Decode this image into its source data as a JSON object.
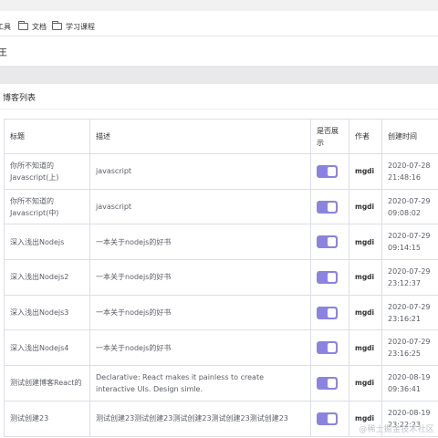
{
  "bookmarks": [
    {
      "label": "工具"
    },
    {
      "label": "文档"
    },
    {
      "label": "学习课程"
    }
  ],
  "header": {
    "crumb": "王"
  },
  "card": {
    "title": "博客列表"
  },
  "table": {
    "columns": [
      "标题",
      "描述",
      "是否展示",
      "作者",
      "创建时间"
    ],
    "rows": [
      {
        "title": "你所不知道的Javascript(上)",
        "desc": "javascript",
        "show": true,
        "author": "mgdi",
        "created": "2020-07-28 21:48:16"
      },
      {
        "title": "你所不知道的Javascript(中)",
        "desc": "javascript",
        "show": true,
        "author": "mgdi",
        "created": "2020-07-29 09:08:02"
      },
      {
        "title": "深入浅出Nodejs",
        "desc": "一本关于nodejs的好书",
        "show": true,
        "author": "mgdi",
        "created": "2020-07-29 09:14:15"
      },
      {
        "title": "深入浅出Nodejs2",
        "desc": "一本关于nodejs的好书",
        "show": true,
        "author": "mgdi",
        "created": "2020-07-29 23:12:37"
      },
      {
        "title": "深入浅出Nodejs3",
        "desc": "一本关于nodejs的好书",
        "show": true,
        "author": "mgdi",
        "created": "2020-07-29 23:16:21"
      },
      {
        "title": "深入浅出Nodejs4",
        "desc": "一本关于nodejs的好书",
        "show": true,
        "author": "mgdi",
        "created": "2020-07-29 23:16:25"
      },
      {
        "title": "测试创建博客React的",
        "desc": "Declarative: React makes it painless to create interactive UIs. Design simle.",
        "show": true,
        "author": "mgdi",
        "created": "2020-08-19 09:36:41"
      },
      {
        "title": "测试创建23",
        "desc": "测试创建23测试创建23测试创建23测试创建23测试创建23",
        "show": true,
        "author": "mgdi",
        "created": "2020-08-19 23:22:23"
      }
    ]
  },
  "watermark": "@稀土掘金技术社区",
  "colors": {
    "switch_on": "#8a84e0",
    "border": "#dcdfe6",
    "band": "#e9e9eb"
  }
}
